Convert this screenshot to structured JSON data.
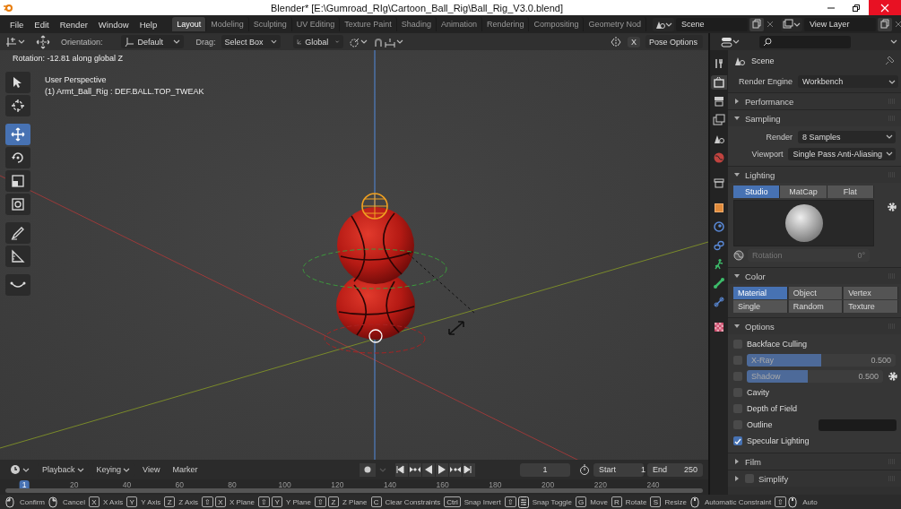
{
  "window": {
    "title": "Blender* [E:\\Gumroad_RIg\\Cartoon_Ball_Rig\\Ball_Rig_V3.0.blend]"
  },
  "menu": [
    "File",
    "Edit",
    "Render",
    "Window",
    "Help"
  ],
  "workspaces": [
    {
      "label": "Layout",
      "selected": true
    },
    {
      "label": "Modeling",
      "selected": false
    },
    {
      "label": "Sculpting",
      "selected": false
    },
    {
      "label": "UV Editing",
      "selected": false
    },
    {
      "label": "Texture Paint",
      "selected": false
    },
    {
      "label": "Shading",
      "selected": false
    },
    {
      "label": "Animation",
      "selected": false
    },
    {
      "label": "Rendering",
      "selected": false
    },
    {
      "label": "Compositing",
      "selected": false
    },
    {
      "label": "Geometry Nod",
      "selected": false
    }
  ],
  "scene_selector": {
    "value": "Scene"
  },
  "view_layer_selector": {
    "value": "View Layer"
  },
  "viewport_header": {
    "orientation_label": "Orientation:",
    "orientation": "Default",
    "drag_label": "Drag:",
    "drag": "Select Box",
    "transform_space": "Global",
    "mirror_x": "X",
    "pose_options": "Pose Options"
  },
  "viewport": {
    "operator_info": "Rotation: -12.81 along global Z",
    "view_name": "User Perspective",
    "object_info": "(1) Armt_Ball_Rig : DEF.BALL.TOP_TWEAK",
    "tools": [
      {
        "kind": "select_box",
        "selected": false
      },
      {
        "kind": "cursor",
        "selected": false
      },
      {
        "kind": "move",
        "selected": true
      },
      {
        "kind": "rotate",
        "selected": false
      },
      {
        "kind": "scale",
        "selected": false
      },
      {
        "kind": "transform",
        "selected": false
      },
      {
        "kind": "annotate",
        "selected": false
      },
      {
        "kind": "measure",
        "selected": false
      },
      {
        "kind": "bend",
        "selected": false
      }
    ]
  },
  "timeline": {
    "menus": [
      {
        "label": "Playback",
        "dropdown": true
      },
      {
        "label": "Keying",
        "dropdown": true
      },
      {
        "label": "View",
        "dropdown": false
      },
      {
        "label": "Marker",
        "dropdown": false
      }
    ],
    "current_frame": "1",
    "start_label": "Start",
    "start": "1",
    "end_label": "End",
    "end": "250",
    "ruler": [
      {
        "label": "1",
        "selected": true
      },
      {
        "label": "20",
        "selected": false
      },
      {
        "label": "40",
        "selected": false
      },
      {
        "label": "60",
        "selected": false
      },
      {
        "label": "80",
        "selected": false
      },
      {
        "label": "100",
        "selected": false
      },
      {
        "label": "120",
        "selected": false
      },
      {
        "label": "140",
        "selected": false
      },
      {
        "label": "160",
        "selected": false
      },
      {
        "label": "180",
        "selected": false
      },
      {
        "label": "200",
        "selected": false
      },
      {
        "label": "220",
        "selected": false
      },
      {
        "label": "240",
        "selected": false
      }
    ]
  },
  "properties": {
    "context": "Scene",
    "render_engine_label": "Render Engine",
    "render_engine": "Workbench",
    "tabs": [
      {
        "kind": "tool",
        "selected": false
      },
      {
        "kind": "render",
        "selected": true
      },
      {
        "kind": "output",
        "selected": false
      },
      {
        "kind": "view_layer",
        "selected": false
      },
      {
        "kind": "scene",
        "selected": false
      },
      {
        "kind": "world",
        "selected": false
      },
      {
        "kind": "collection",
        "selected": false
      },
      {
        "kind": "object",
        "selected": false
      },
      {
        "kind": "physics",
        "selected": false
      },
      {
        "kind": "constraint",
        "selected": false
      },
      {
        "kind": "armature",
        "selected": false
      },
      {
        "kind": "bone",
        "selected": false
      },
      {
        "kind": "bone_constraint",
        "selected": false
      },
      {
        "kind": "texture",
        "selected": false
      }
    ],
    "sections": [
      {
        "title": "Performance",
        "expanded": false
      },
      {
        "title": "Sampling",
        "expanded": true,
        "items": [
          {
            "kind": "dropdown",
            "label": "Render",
            "value": "8 Samples"
          },
          {
            "kind": "dropdown",
            "label": "Viewport",
            "value": "Single Pass Anti-Aliasing"
          }
        ]
      },
      {
        "title": "Lighting",
        "expanded": true,
        "items": [
          {
            "kind": "segmented",
            "options": [
              {
                "label": "Studio",
                "selected": true
              },
              {
                "label": "MatCap",
                "selected": false
              },
              {
                "label": "Flat",
                "selected": false
              }
            ]
          },
          {
            "kind": "studio_preview"
          },
          {
            "kind": "rotation",
            "label": "Rotation",
            "value": "0°",
            "disabled": true
          }
        ]
      },
      {
        "title": "Color",
        "expanded": true,
        "items": [
          {
            "kind": "option_grid",
            "options": [
              {
                "label": "Material",
                "selected": true
              },
              {
                "label": "Object",
                "selected": false
              },
              {
                "label": "Vertex",
                "selected": false
              },
              {
                "label": "Single",
                "selected": false
              },
              {
                "label": "Random",
                "selected": false
              },
              {
                "label": "Texture",
                "selected": false
              }
            ]
          }
        ]
      },
      {
        "title": "Options",
        "expanded": true,
        "items": [
          {
            "kind": "checkbox",
            "label": "Backface Culling",
            "checked": false
          },
          {
            "kind": "checkbox_slider",
            "label": "X-Ray",
            "checked": false,
            "level": 0.5,
            "reading": "0.500",
            "gear": false
          },
          {
            "kind": "checkbox_slider",
            "label": "Shadow",
            "checked": false,
            "level": 0.45,
            "reading": "0.500",
            "gear": true
          },
          {
            "kind": "checkbox",
            "label": "Cavity",
            "checked": false
          },
          {
            "kind": "checkbox",
            "label": "Depth of Field",
            "checked": false
          },
          {
            "kind": "checkbox_swatch",
            "label": "Outline",
            "checked": false
          },
          {
            "kind": "checkbox",
            "label": "Specular Lighting",
            "checked": true
          }
        ]
      },
      {
        "title": "Film",
        "expanded": false
      },
      {
        "title": "Simplify",
        "expanded": false,
        "checked": false
      }
    ]
  },
  "status_bar": [
    {
      "keys": [
        {
          "kind": "mouse_left"
        }
      ],
      "label": "Confirm"
    },
    {
      "keys": [
        {
          "kind": "mouse_right"
        }
      ],
      "label": "Cancel"
    },
    {
      "keys": [
        {
          "kind": "key",
          "text": "X"
        }
      ],
      "label": "X Axis"
    },
    {
      "keys": [
        {
          "kind": "key",
          "text": "Y"
        }
      ],
      "label": "Y Axis"
    },
    {
      "keys": [
        {
          "kind": "key",
          "text": "Z"
        }
      ],
      "label": "Z Axis"
    },
    {
      "keys": [
        {
          "kind": "key",
          "text": "⇧"
        },
        {
          "kind": "key",
          "text": "X"
        }
      ],
      "label": "X Plane"
    },
    {
      "keys": [
        {
          "kind": "key",
          "text": "⇧"
        },
        {
          "kind": "key",
          "text": "Y"
        }
      ],
      "label": "Y Plane"
    },
    {
      "keys": [
        {
          "kind": "key",
          "text": "⇧"
        },
        {
          "kind": "key",
          "text": "Z"
        }
      ],
      "label": "Z Plane"
    },
    {
      "keys": [
        {
          "kind": "key",
          "text": "C"
        }
      ],
      "label": "Clear Constraints"
    },
    {
      "keys": [
        {
          "kind": "key",
          "text": "Ctrl"
        }
      ],
      "label": "Snap Invert"
    },
    {
      "keys": [
        {
          "kind": "key",
          "text": "⇧"
        },
        {
          "kind": "snap_key"
        }
      ],
      "label": "Snap Toggle"
    },
    {
      "keys": [
        {
          "kind": "key",
          "text": "G"
        }
      ],
      "label": "Move"
    },
    {
      "keys": [
        {
          "kind": "key",
          "text": "R"
        }
      ],
      "label": "Rotate"
    },
    {
      "keys": [
        {
          "kind": "key",
          "text": "S"
        }
      ],
      "label": "Resize"
    },
    {
      "keys": [
        {
          "kind": "mouse_middle"
        }
      ],
      "label": "Automatic Constraint"
    },
    {
      "keys": [
        {
          "kind": "key",
          "text": "⇧"
        },
        {
          "kind": "mouse_middle"
        }
      ],
      "label": "Auto"
    }
  ]
}
